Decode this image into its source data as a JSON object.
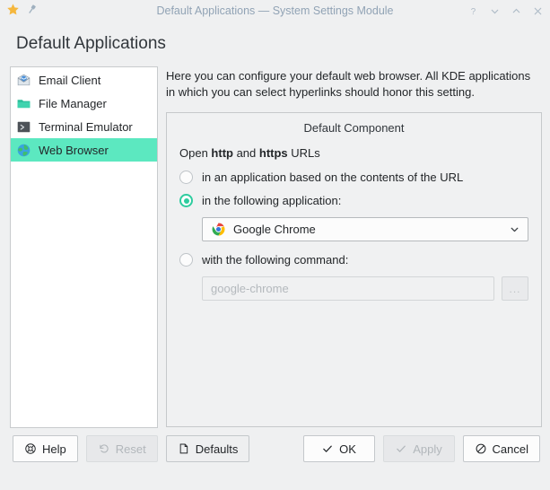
{
  "titlebar": {
    "title": "Default Applications — System Settings Module",
    "star_icon": "star-icon",
    "pin_icon": "pin-icon",
    "help_label": "?",
    "minimize_icon": "chevron-down-icon",
    "maximize_icon": "chevron-up-icon",
    "close_icon": "close-icon"
  },
  "header": {
    "page_title": "Default Applications"
  },
  "sidebar": {
    "items": [
      {
        "label": "Email Client",
        "icon": "email-icon",
        "selected": false
      },
      {
        "label": "File Manager",
        "icon": "folder-icon",
        "selected": false
      },
      {
        "label": "Terminal Emulator",
        "icon": "terminal-icon",
        "selected": false
      },
      {
        "label": "Web Browser",
        "icon": "globe-icon",
        "selected": true
      }
    ]
  },
  "main": {
    "description": "Here you can configure your default web browser. All KDE applications in which you can select hyperlinks should honor this setting.",
    "group": {
      "title": "Default Component",
      "open_line": {
        "prefix": "Open ",
        "bold1": "http",
        "middle": " and ",
        "bold2": "https",
        "suffix": " URLs"
      },
      "radios": [
        {
          "label": "in an application based on the contents of the URL",
          "selected": false
        },
        {
          "label": "in the following application:",
          "selected": true
        },
        {
          "label": "with the following command:",
          "selected": false
        }
      ],
      "combobox": {
        "value": "Google Chrome",
        "icon": "chrome-icon",
        "arrow_icon": "chevron-down-icon"
      },
      "command": {
        "value": "",
        "placeholder": "google-chrome",
        "browse_label": "...",
        "enabled": false
      }
    }
  },
  "footer": {
    "buttons": [
      {
        "label": "Help",
        "icon": "lifebuoy-icon",
        "disabled": false
      },
      {
        "label": "Reset",
        "icon": "undo-icon",
        "disabled": true
      },
      {
        "label": "Defaults",
        "icon": "document-icon",
        "disabled": false
      },
      {
        "label": "OK",
        "icon": "check-icon",
        "disabled": false
      },
      {
        "label": "Apply",
        "icon": "check-icon",
        "disabled": true
      },
      {
        "label": "Cancel",
        "icon": "cancel-icon",
        "disabled": false
      }
    ]
  },
  "colors": {
    "accent": "#2ecc9f",
    "selection": "#5ce8c0",
    "window_bg": "#eff0f1",
    "title_text": "#91a3b5"
  }
}
